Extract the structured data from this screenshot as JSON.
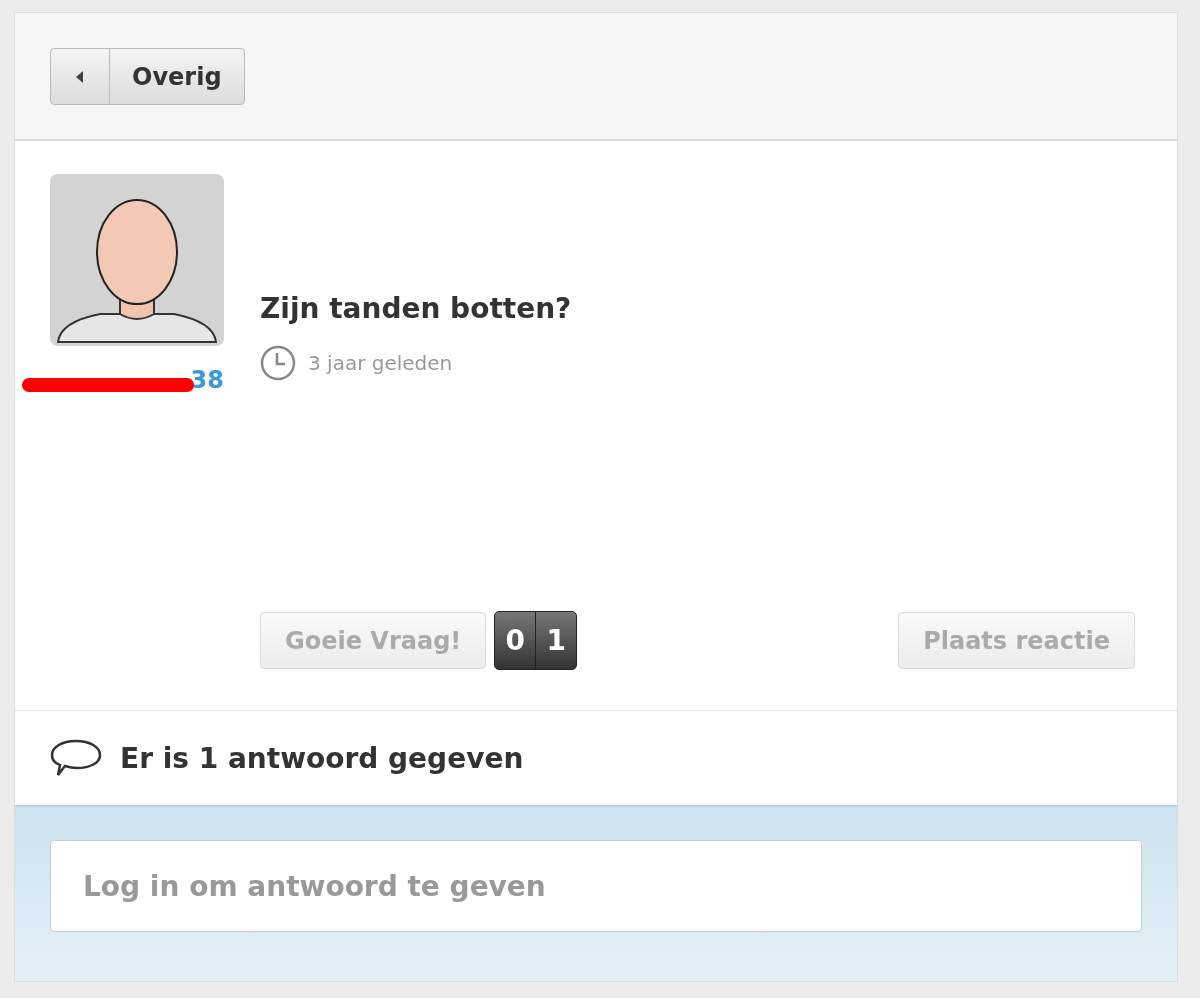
{
  "back_button": {
    "label": "Overig"
  },
  "question": {
    "username": "38",
    "title": "Zijn tanden botten?",
    "time": "3 jaar geleden"
  },
  "vote_button": {
    "label": "Goeie Vraag!",
    "disabled": true
  },
  "vote_counter": [
    "0",
    "1"
  ],
  "reply_button": {
    "label": "Plaats reactie",
    "disabled": true
  },
  "answers_heading": "Er is 1 antwoord gegeven",
  "answer_field": {
    "placeholder": "Log in om antwoord te geven"
  }
}
